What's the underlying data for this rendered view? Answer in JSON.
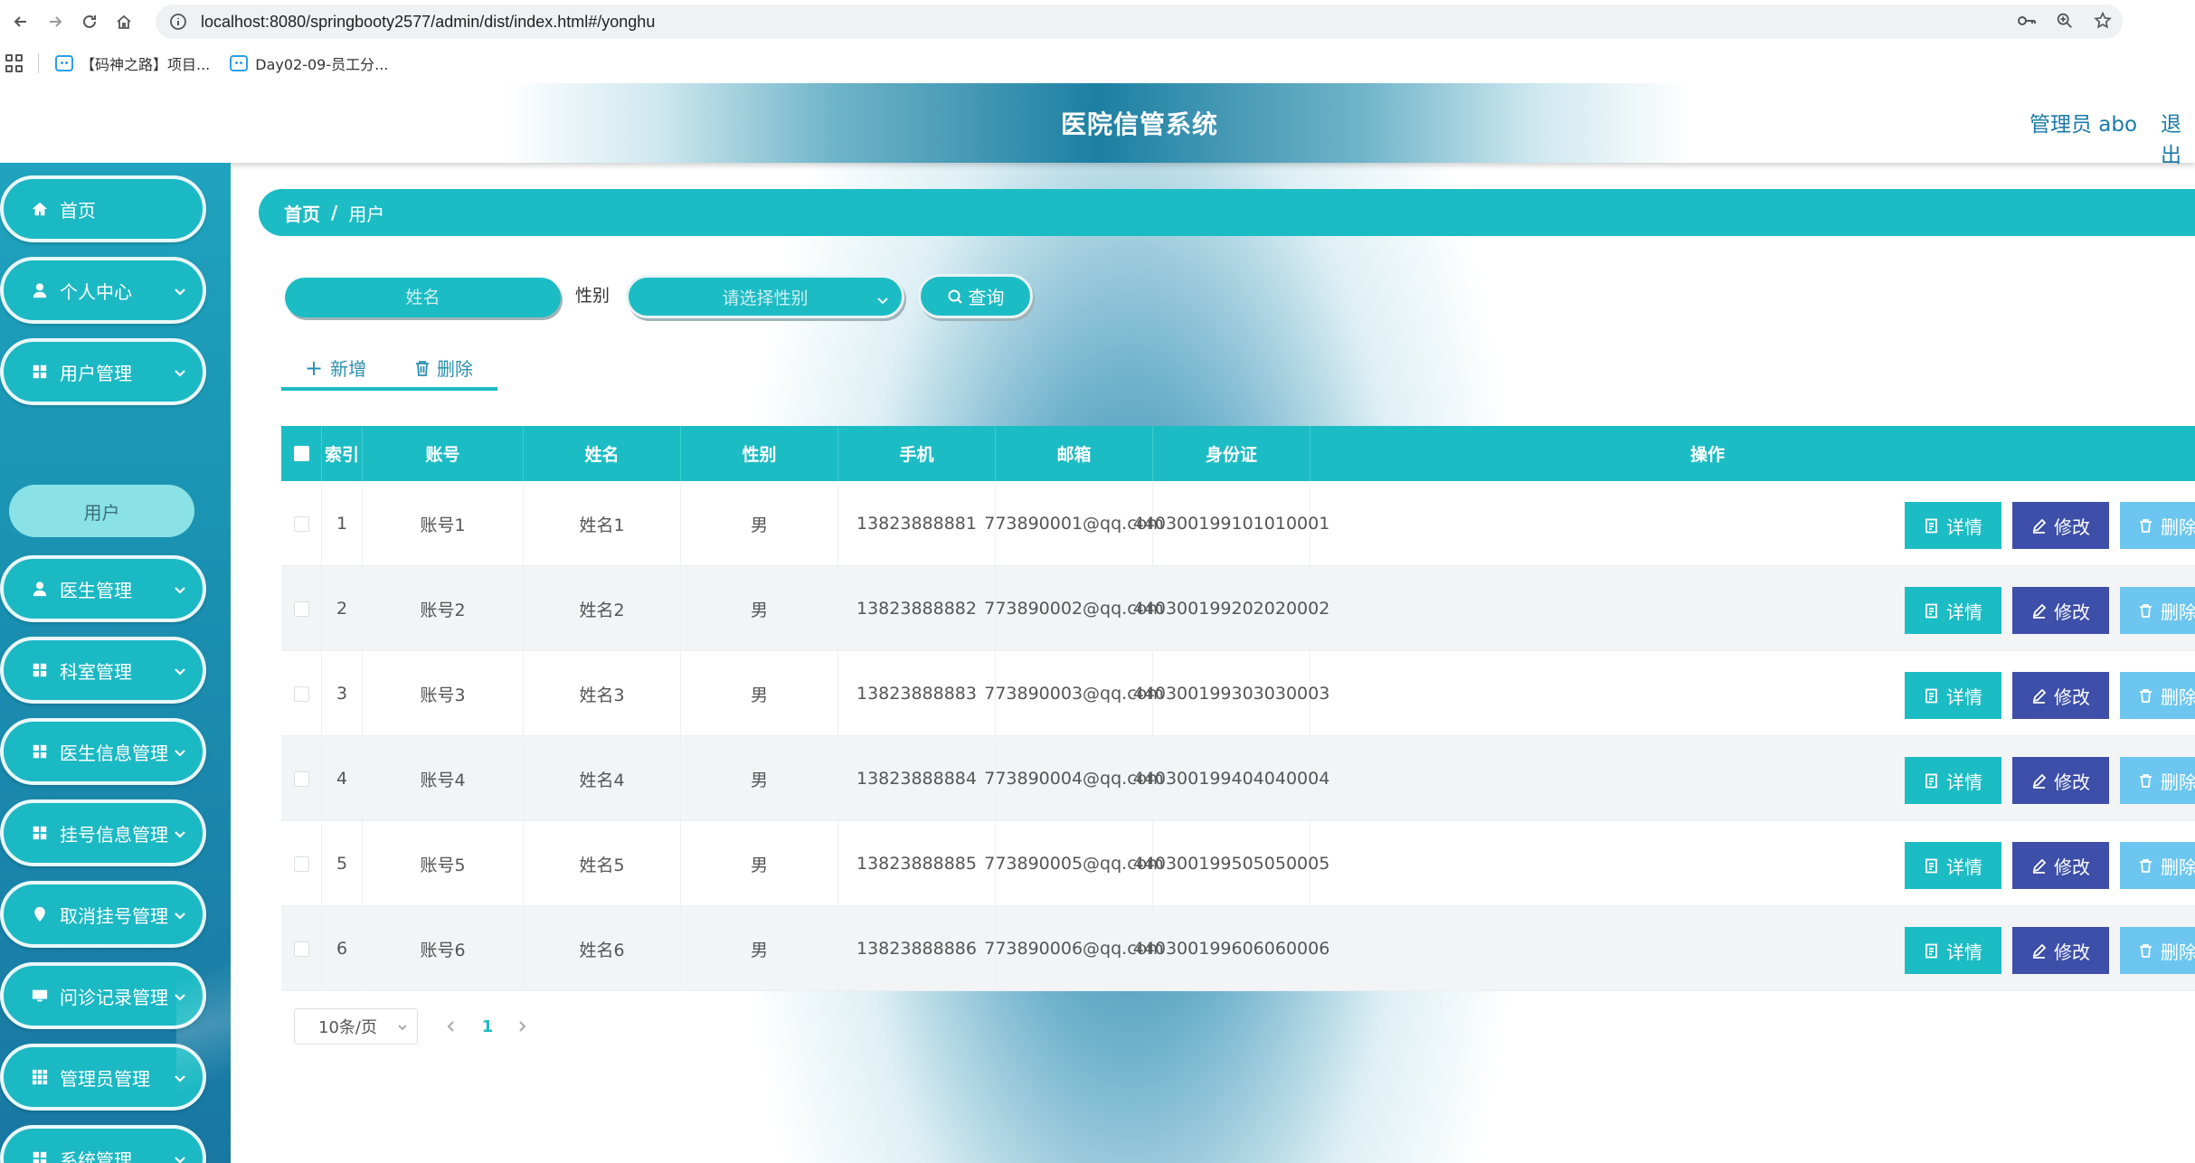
{
  "browser": {
    "url": "localhost:8080/springbooty2577/admin/dist/index.html#/yonghu",
    "bookmarks": [
      {
        "label": "【码神之路】项目..."
      },
      {
        "label": "Day02-09-员工分..."
      }
    ]
  },
  "header": {
    "title": "医院信管系统",
    "user": "管理员 abo",
    "logout": "退出"
  },
  "sidebar": {
    "items": [
      {
        "label": "首页",
        "icon": "home-icon",
        "has_arrow": false
      },
      {
        "label": "个人中心",
        "icon": "user-icon",
        "has_arrow": true
      },
      {
        "label": "用户管理",
        "icon": "grid-icon",
        "has_arrow": true
      },
      {
        "label": "医生管理",
        "icon": "user-icon",
        "has_arrow": true
      },
      {
        "label": "科室管理",
        "icon": "grid-icon",
        "has_arrow": true
      },
      {
        "label": "医生信息管理",
        "icon": "grid-icon",
        "has_arrow": true
      },
      {
        "label": "挂号信息管理",
        "icon": "grid-icon",
        "has_arrow": true
      },
      {
        "label": "取消挂号管理",
        "icon": "location-icon",
        "has_arrow": true
      },
      {
        "label": "问诊记录管理",
        "icon": "monitor-icon",
        "has_arrow": true
      },
      {
        "label": "管理员管理",
        "icon": "apps-icon",
        "has_arrow": true
      },
      {
        "label": "系统管理",
        "icon": "grid-icon",
        "has_arrow": true
      }
    ],
    "active_sub": "用户"
  },
  "breadcrumb": {
    "home": "首页",
    "sep": "/",
    "current": "用户"
  },
  "search": {
    "name_placeholder": "姓名",
    "gender_label": "性别",
    "gender_placeholder": "请选择性别",
    "query_label": "查询"
  },
  "actions": {
    "add": "新增",
    "delete": "删除"
  },
  "table": {
    "columns": [
      "索引",
      "账号",
      "姓名",
      "性别",
      "手机",
      "邮箱",
      "身份证",
      "操作"
    ],
    "rows": [
      {
        "index": "1",
        "account": "账号1",
        "name": "姓名1",
        "gender": "男",
        "phone": "13823888881",
        "email": "773890001@qq.com",
        "id_card": "440300199101010001"
      },
      {
        "index": "2",
        "account": "账号2",
        "name": "姓名2",
        "gender": "男",
        "phone": "13823888882",
        "email": "773890002@qq.com",
        "id_card": "440300199202020002"
      },
      {
        "index": "3",
        "account": "账号3",
        "name": "姓名3",
        "gender": "男",
        "phone": "13823888883",
        "email": "773890003@qq.com",
        "id_card": "440300199303030003"
      },
      {
        "index": "4",
        "account": "账号4",
        "name": "姓名4",
        "gender": "男",
        "phone": "13823888884",
        "email": "773890004@qq.com",
        "id_card": "440300199404040004"
      },
      {
        "index": "5",
        "account": "账号5",
        "name": "姓名5",
        "gender": "男",
        "phone": "13823888885",
        "email": "773890005@qq.com",
        "id_card": "440300199505050005"
      },
      {
        "index": "6",
        "account": "账号6",
        "name": "姓名6",
        "gender": "男",
        "phone": "13823888886",
        "email": "773890006@qq.com",
        "id_card": "440300199606060006"
      }
    ],
    "row_actions": {
      "detail": "详情",
      "edit": "修改",
      "delete": "删除"
    }
  },
  "pagination": {
    "page_size": "10条/页",
    "current_page": "1"
  },
  "colors": {
    "accent": "#1cbcc4",
    "edit": "#3d4fa9",
    "delete": "#6cc6f0",
    "link": "#1a7aa7"
  }
}
